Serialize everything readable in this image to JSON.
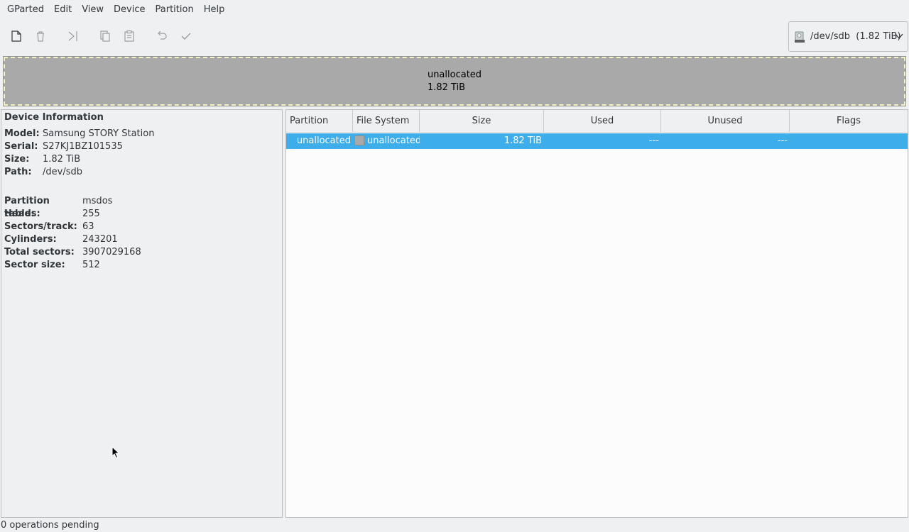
{
  "menubar": {
    "items": [
      "GParted",
      "Edit",
      "View",
      "Device",
      "Partition",
      "Help"
    ]
  },
  "toolbar": {
    "buttons": [
      {
        "icon": "new-icon"
      },
      {
        "icon": "delete-icon"
      },
      {
        "icon": "resize-move-icon"
      },
      {
        "icon": "copy-icon"
      },
      {
        "icon": "paste-icon"
      },
      {
        "icon": "undo-icon"
      },
      {
        "icon": "apply-icon"
      }
    ]
  },
  "device_selector": {
    "path": "/dev/sdb",
    "size": "(1.82 TiB)",
    "icon": "disk-drive-icon"
  },
  "disk_visual": {
    "label": "unallocated",
    "size": "1.82 TiB",
    "fill_color": "#a9a9a9"
  },
  "device_info": {
    "title": "Device Information",
    "model_label": "Model:",
    "model": "Samsung STORY Station",
    "serial_label": "Serial:",
    "serial": "S27KJ1BZ101535",
    "size_label": "Size:",
    "size": "1.82 TiB",
    "path_label": "Path:",
    "path": "/dev/sdb",
    "partition_table_label": "Partition table:",
    "partition_table": "msdos",
    "heads_label": "Heads:",
    "heads": "255",
    "sectors_track_label": "Sectors/track:",
    "sectors_track": "63",
    "cylinders_label": "Cylinders:",
    "cylinders": "243201",
    "total_sectors_label": "Total sectors:",
    "total_sectors": "3907029168",
    "sector_size_label": "Sector size:",
    "sector_size": "512"
  },
  "partition_table": {
    "columns": [
      "Partition",
      "File System",
      "Size",
      "Used",
      "Unused",
      "Flags"
    ],
    "rows": [
      {
        "partition": "unallocated",
        "file_system": "unallocated",
        "size": "1.82 TiB",
        "used": "---",
        "unused": "---",
        "flags": ""
      }
    ]
  },
  "status": {
    "text": "0 operations pending"
  },
  "colors": {
    "selection": "#3daee9",
    "unallocated": "#a9a9a9"
  }
}
